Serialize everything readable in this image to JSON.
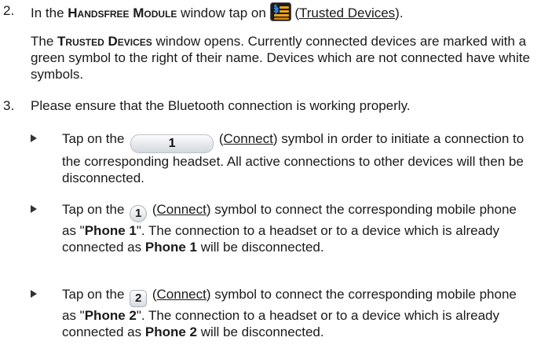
{
  "step2": {
    "number": "2.",
    "pre": "In the ",
    "module_name": "Handsfree Module",
    "mid": " window tap on ",
    "link": "Trusted Devices",
    "paren_open": "(",
    "paren_close": ").",
    "window_name": "Trusted Devices",
    "p2_pre": "The ",
    "p2_rest": " window opens. Currently connected devices are marked with a green symbol to the right of their name. Devices which are not connected have white symbols."
  },
  "step3": {
    "number": "3.",
    "text": "Please ensure that the Bluetooth connection is working properly."
  },
  "bullets": [
    {
      "pre": "Tap on the ",
      "symbol": "1",
      "open": " (",
      "link": "Connect",
      "post": ") symbol in order to initiate a connection to the corresponding headset. All active connections to other devices will then be disconnected."
    },
    {
      "pre": "Tap on the ",
      "symbol": "1",
      "open": " (",
      "link": "Connect",
      "post1": ") symbol to connect the corresponding mobile phone as \"",
      "phone": "Phone 1",
      "post2": "\". The connection to a headset or to a device which is already connected as ",
      "phone_again": "Phone 1",
      "post3": " will be disconnected."
    },
    {
      "pre": "Tap on the ",
      "symbol": "2",
      "open": " (",
      "link": "Connect",
      "post1": ") symbol to connect the corresponding mobile phone as \"",
      "phone": "Phone 2",
      "post2": "\". The connection to a headset or to a device which is already connected as ",
      "phone_again": "Phone 2",
      "post3": " will be disconnected."
    }
  ],
  "icons": {
    "trusted_devices": "bluetooth-list-icon",
    "bullet": "triangle-bullet-icon"
  },
  "colors": {
    "trusted_icon_bg": "#1c1c1c",
    "trusted_icon_bars": "#f3a21b",
    "bluetooth_blue": "#2f8fe8"
  }
}
